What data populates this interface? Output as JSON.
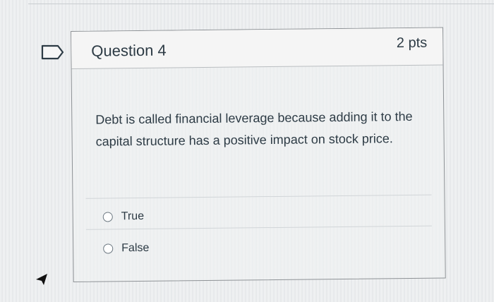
{
  "question": {
    "title": "Question 4",
    "points": "2 pts",
    "text": "Debt is called financial leverage because adding it to the capital structure has a positive impact on stock price.",
    "answers": [
      {
        "label": "True",
        "selected": false
      },
      {
        "label": "False",
        "selected": false
      }
    ]
  },
  "colors": {
    "text": "#2d3b45",
    "header_bg": "#f5f5f5",
    "border": "#8e9296",
    "flag_stroke": "#2d3b45"
  },
  "icons": {
    "flag": "bookmark-flag-icon",
    "cursor": "mouse-pointer-icon"
  }
}
